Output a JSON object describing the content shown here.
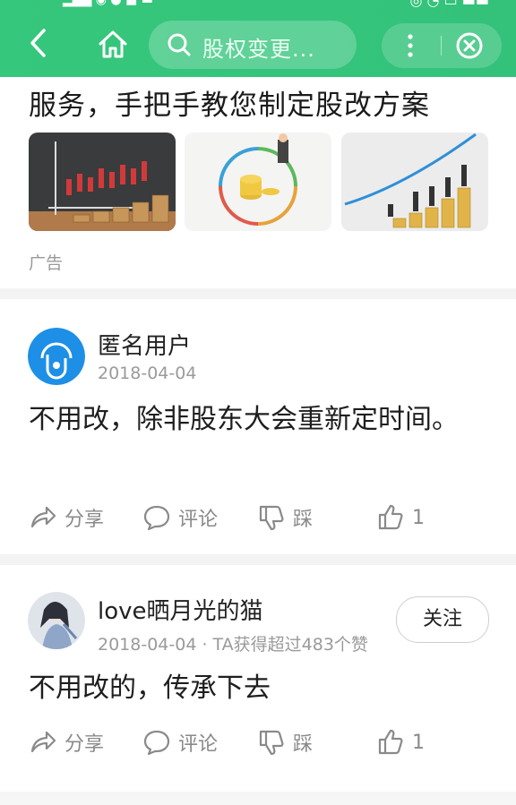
{
  "header": {
    "search_text": "股权变更...",
    "colors": {
      "bar": "#35c77c"
    }
  },
  "ad": {
    "title": "服务，手把手教您制定股改方案",
    "label": "广告"
  },
  "answers": [
    {
      "username": "匿名用户",
      "date": "2018-04-04",
      "text": "不用改，除非股东大会重新定时间。",
      "actions": {
        "share": "分享",
        "comment": "评论",
        "dislike": "踩",
        "like_count": "1"
      }
    },
    {
      "username": "love晒月光的猫",
      "meta": "2018-04-04 · TA获得超过483个赞",
      "follow_label": "关注",
      "text": "不用改的，传承下去",
      "actions": {
        "share": "分享",
        "comment": "评论",
        "dislike": "踩",
        "like_count": "1"
      }
    }
  ]
}
